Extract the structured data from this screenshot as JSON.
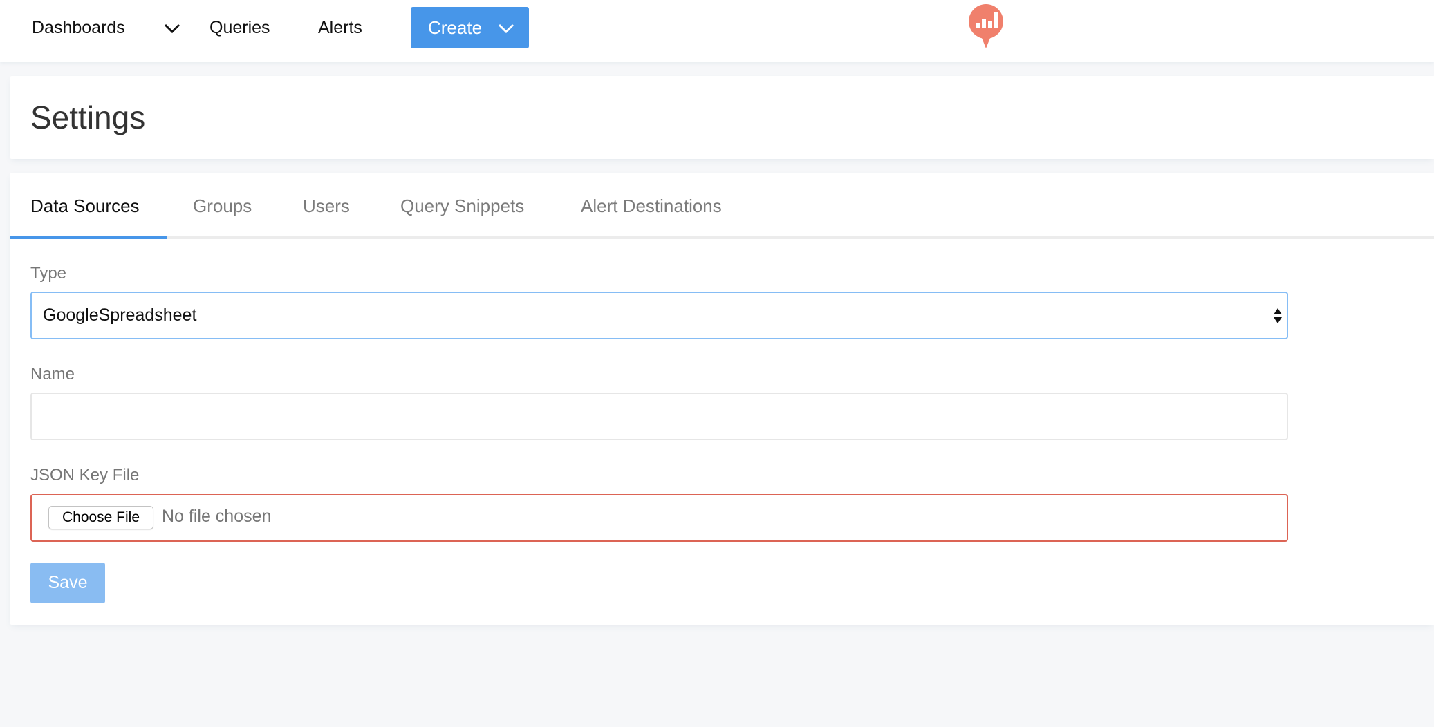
{
  "topbar": {
    "nav": [
      {
        "label": "Dashboards",
        "has_dropdown": true
      },
      {
        "label": "Queries"
      },
      {
        "label": "Alerts"
      }
    ],
    "create_button": {
      "label": "Create",
      "icon": "chevron-down-icon"
    },
    "logo": {
      "icon": "redash-logo-icon",
      "color": "#f0806c"
    }
  },
  "page": {
    "title": "Settings"
  },
  "tabs": [
    {
      "label": "Data Sources",
      "active": true
    },
    {
      "label": "Groups",
      "active": false
    },
    {
      "label": "Users",
      "active": false
    },
    {
      "label": "Query Snippets",
      "active": false
    },
    {
      "label": "Alert Destinations",
      "active": false
    }
  ],
  "form": {
    "type": {
      "label": "Type",
      "value": "GoogleSpreadsheet"
    },
    "name": {
      "label": "Name",
      "value": "",
      "placeholder": ""
    },
    "json_key_file": {
      "label": "JSON Key File",
      "button_label": "Choose File",
      "status": "No file chosen"
    },
    "save_label": "Save"
  },
  "colors": {
    "accent": "#4796e9",
    "save_disabled": "#89bcf2",
    "error_border": "#dc6455",
    "focus_border": "#86bdf5",
    "background": "#f6f7f9"
  }
}
